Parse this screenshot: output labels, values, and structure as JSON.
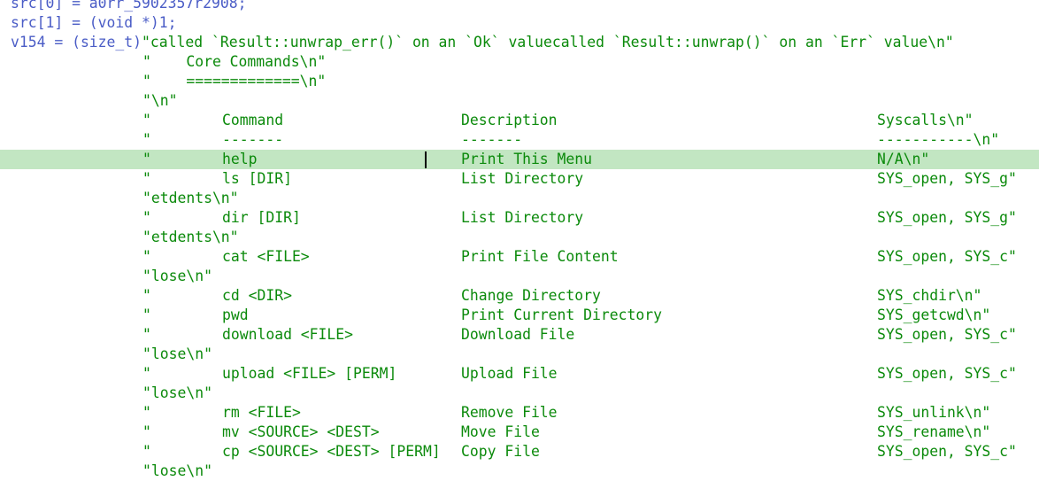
{
  "editor": {
    "lines": [
      {
        "code": "src[0] = a0rr_5902357r2908;"
      },
      {
        "code": "src[1] = (void *)1;"
      },
      {
        "code": "v154 = (size_t)",
        "str": "\"called `Result::unwrap_err()` on an `Ok` valuecalled `Result::unwrap()` on an `Err` value\\n\""
      },
      {
        "str": "\"    Core Commands\\n\""
      },
      {
        "str": "\"    =============\\n\""
      },
      {
        "str": "\"\\n\""
      },
      {
        "q": "\"",
        "cmd": "Command",
        "desc": "Description",
        "sys": "Syscalls\\n\""
      },
      {
        "q": "\"",
        "cmd": "-------",
        "desc": "-------",
        "sys": "-----------\\n\""
      },
      {
        "q": "\"",
        "cmd": "help",
        "desc": "Print This Menu",
        "sys": "N/A\\n\"",
        "highlight": true,
        "caret": true
      },
      {
        "q": "\"",
        "cmd": "ls [DIR]",
        "desc": "List Directory",
        "sys": "SYS_open, SYS_g\""
      },
      {
        "str": "\"etdents\\n\""
      },
      {
        "q": "\"",
        "cmd": "dir [DIR]",
        "desc": "List Directory",
        "sys": "SYS_open, SYS_g\""
      },
      {
        "str": "\"etdents\\n\""
      },
      {
        "q": "\"",
        "cmd": "cat <FILE>",
        "desc": "Print File Content",
        "sys": "SYS_open, SYS_c\""
      },
      {
        "str": "\"lose\\n\""
      },
      {
        "q": "\"",
        "cmd": "cd <DIR>",
        "desc": "Change Directory",
        "sys": "SYS_chdir\\n\""
      },
      {
        "q": "\"",
        "cmd": "pwd",
        "desc": "Print Current Directory",
        "sys": "SYS_getcwd\\n\""
      },
      {
        "q": "\"",
        "cmd": "download <FILE>",
        "desc": "Download File",
        "sys": "SYS_open, SYS_c\""
      },
      {
        "str": "\"lose\\n\""
      },
      {
        "q": "\"",
        "cmd": "upload <FILE> [PERM]",
        "desc": "Upload File",
        "sys": "SYS_open, SYS_c\""
      },
      {
        "str": "\"lose\\n\""
      },
      {
        "q": "\"",
        "cmd": "rm <FILE>",
        "desc": "Remove File",
        "sys": "SYS_unlink\\n\""
      },
      {
        "q": "\"",
        "cmd": "mv <SOURCE> <DEST>",
        "desc": "Move File",
        "sys": "SYS_rename\\n\""
      },
      {
        "q": "\"",
        "cmd": "cp <SOURCE> <DEST> [PERM]",
        "desc": "Copy File",
        "sys": "SYS_open, SYS_c\""
      },
      {
        "str": "\"lose\\n\""
      }
    ]
  },
  "colors": {
    "code": "#4a5cc6",
    "string": "#0b8a0b",
    "highlight": "#c2e6c2"
  }
}
